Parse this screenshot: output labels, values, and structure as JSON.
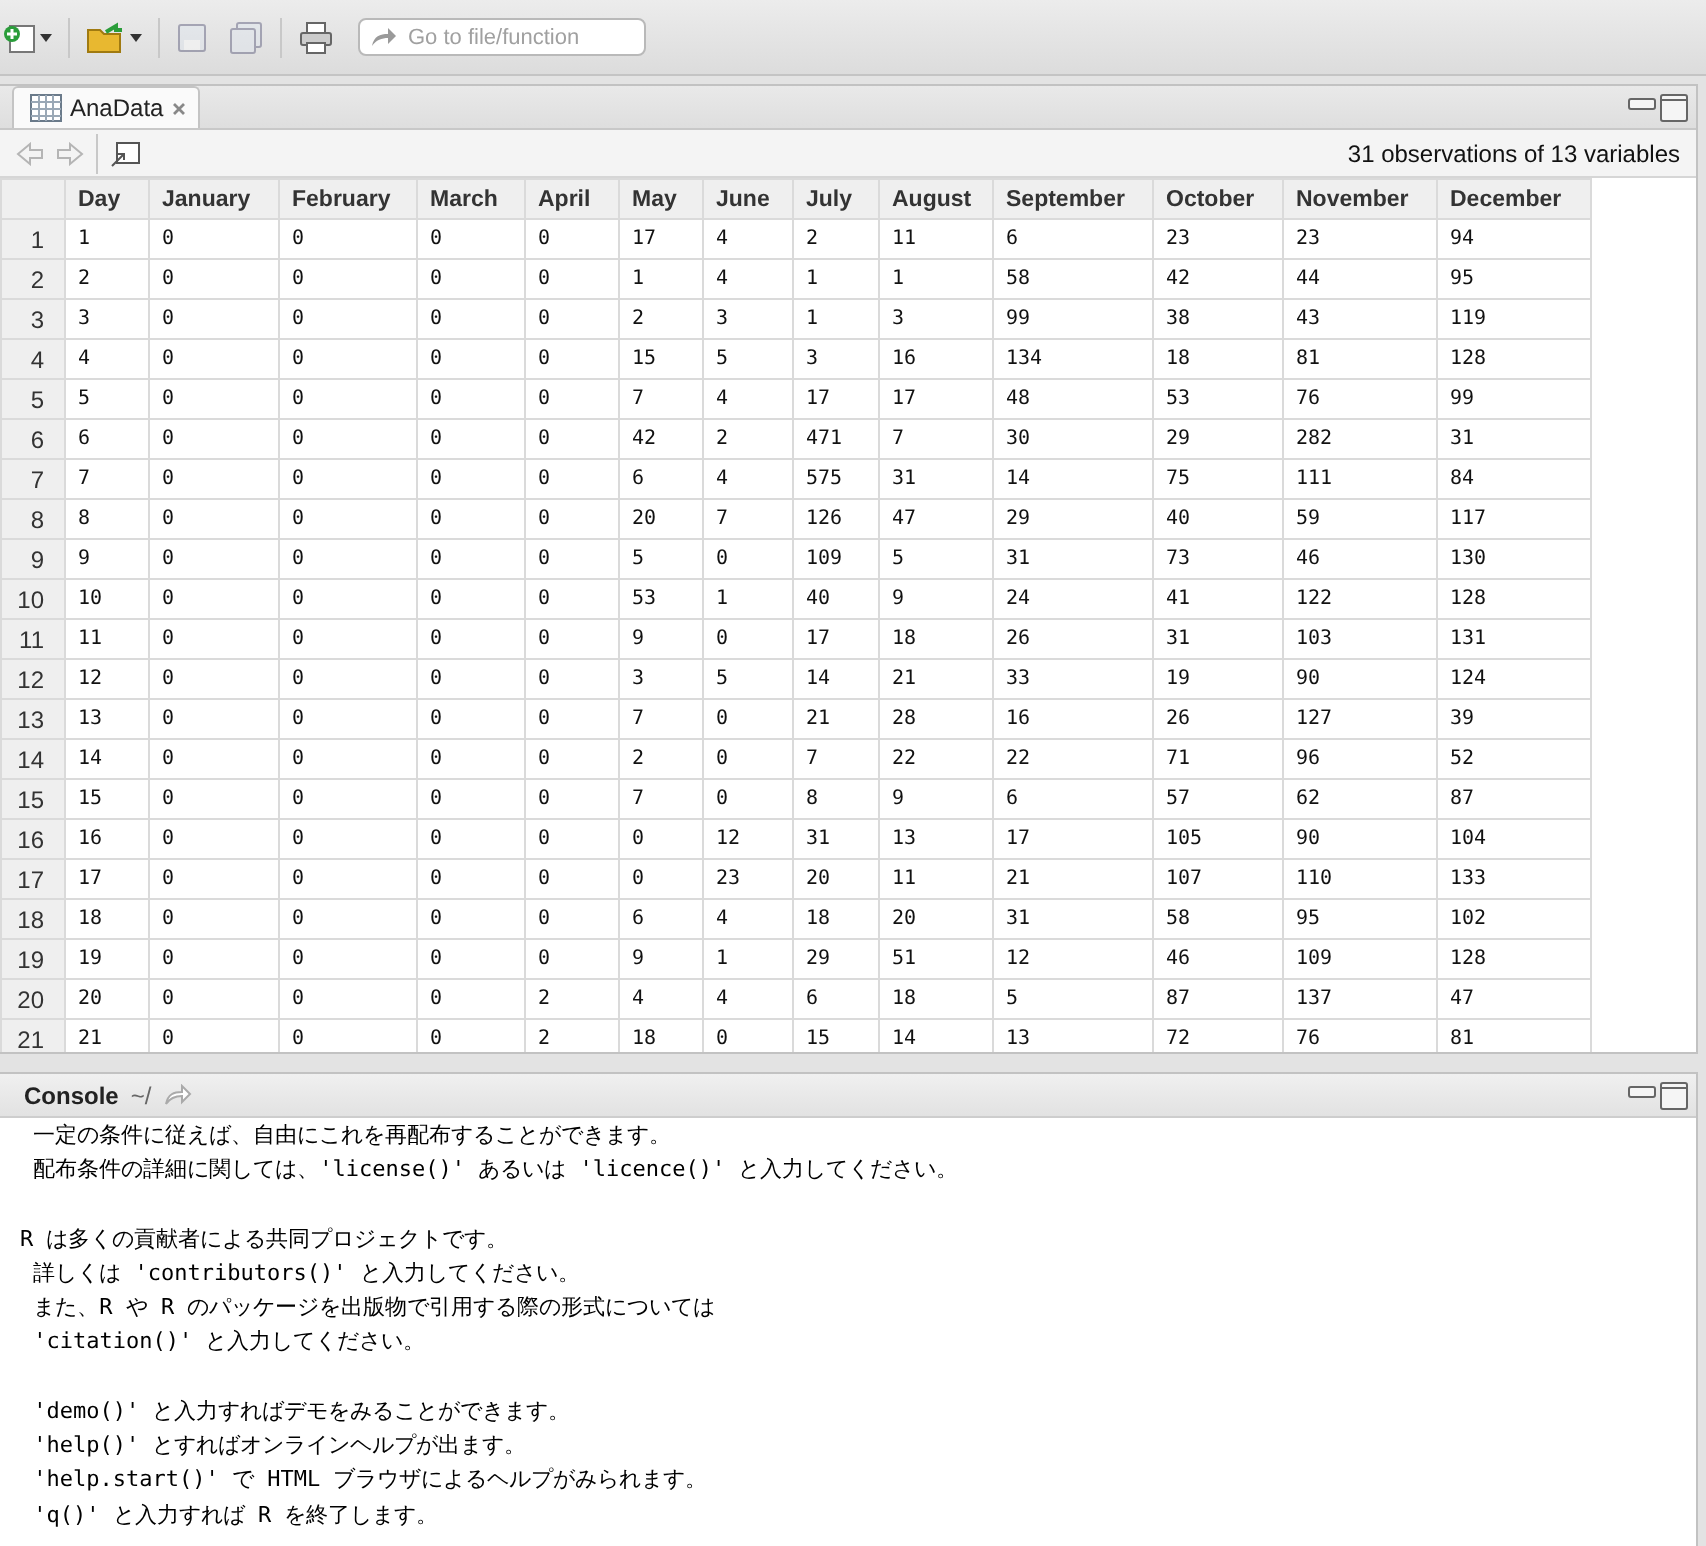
{
  "toolbar": {
    "goto_placeholder": "Go to file/function"
  },
  "data_panel": {
    "tab": {
      "label": "AnaData",
      "selected": true
    },
    "summary": "31 observations of 13 variables"
  },
  "table": {
    "columns": [
      "Day",
      "January",
      "February",
      "March",
      "April",
      "May",
      "June",
      "July",
      "August",
      "September",
      "October",
      "November",
      "December"
    ],
    "rows": [
      {
        "number": "1",
        "cells": [
          "1",
          "0",
          "0",
          "0",
          "0",
          "17",
          "4",
          "2",
          "11",
          "6",
          "23",
          "23",
          "94"
        ]
      },
      {
        "number": "2",
        "cells": [
          "2",
          "0",
          "0",
          "0",
          "0",
          "1",
          "4",
          "1",
          "1",
          "58",
          "42",
          "44",
          "95"
        ]
      },
      {
        "number": "3",
        "cells": [
          "3",
          "0",
          "0",
          "0",
          "0",
          "2",
          "3",
          "1",
          "3",
          "99",
          "38",
          "43",
          "119"
        ]
      },
      {
        "number": "4",
        "cells": [
          "4",
          "0",
          "0",
          "0",
          "0",
          "15",
          "5",
          "3",
          "16",
          "134",
          "18",
          "81",
          "128"
        ]
      },
      {
        "number": "5",
        "cells": [
          "5",
          "0",
          "0",
          "0",
          "0",
          "7",
          "4",
          "17",
          "17",
          "48",
          "53",
          "76",
          "99"
        ]
      },
      {
        "number": "6",
        "cells": [
          "6",
          "0",
          "0",
          "0",
          "0",
          "42",
          "2",
          "471",
          "7",
          "30",
          "29",
          "282",
          "31"
        ]
      },
      {
        "number": "7",
        "cells": [
          "7",
          "0",
          "0",
          "0",
          "0",
          "6",
          "4",
          "575",
          "31",
          "14",
          "75",
          "111",
          "84"
        ]
      },
      {
        "number": "8",
        "cells": [
          "8",
          "0",
          "0",
          "0",
          "0",
          "20",
          "7",
          "126",
          "47",
          "29",
          "40",
          "59",
          "117"
        ]
      },
      {
        "number": "9",
        "cells": [
          "9",
          "0",
          "0",
          "0",
          "0",
          "5",
          "0",
          "109",
          "5",
          "31",
          "73",
          "46",
          "130"
        ]
      },
      {
        "number": "10",
        "cells": [
          "10",
          "0",
          "0",
          "0",
          "0",
          "53",
          "1",
          "40",
          "9",
          "24",
          "41",
          "122",
          "128"
        ]
      },
      {
        "number": "11",
        "cells": [
          "11",
          "0",
          "0",
          "0",
          "0",
          "9",
          "0",
          "17",
          "18",
          "26",
          "31",
          "103",
          "131"
        ]
      },
      {
        "number": "12",
        "cells": [
          "12",
          "0",
          "0",
          "0",
          "0",
          "3",
          "5",
          "14",
          "21",
          "33",
          "19",
          "90",
          "124"
        ]
      },
      {
        "number": "13",
        "cells": [
          "13",
          "0",
          "0",
          "0",
          "0",
          "7",
          "0",
          "21",
          "28",
          "16",
          "26",
          "127",
          "39"
        ]
      },
      {
        "number": "14",
        "cells": [
          "14",
          "0",
          "0",
          "0",
          "0",
          "2",
          "0",
          "7",
          "22",
          "22",
          "71",
          "96",
          "52"
        ]
      },
      {
        "number": "15",
        "cells": [
          "15",
          "0",
          "0",
          "0",
          "0",
          "7",
          "0",
          "8",
          "9",
          "6",
          "57",
          "62",
          "87"
        ]
      },
      {
        "number": "16",
        "cells": [
          "16",
          "0",
          "0",
          "0",
          "0",
          "0",
          "12",
          "31",
          "13",
          "17",
          "105",
          "90",
          "104"
        ]
      },
      {
        "number": "17",
        "cells": [
          "17",
          "0",
          "0",
          "0",
          "0",
          "0",
          "23",
          "20",
          "11",
          "21",
          "107",
          "110",
          "133"
        ]
      },
      {
        "number": "18",
        "cells": [
          "18",
          "0",
          "0",
          "0",
          "0",
          "6",
          "4",
          "18",
          "20",
          "31",
          "58",
          "95",
          "102"
        ]
      },
      {
        "number": "19",
        "cells": [
          "19",
          "0",
          "0",
          "0",
          "0",
          "9",
          "1",
          "29",
          "51",
          "12",
          "46",
          "109",
          "128"
        ]
      },
      {
        "number": "20",
        "cells": [
          "20",
          "0",
          "0",
          "0",
          "2",
          "4",
          "4",
          "6",
          "18",
          "5",
          "87",
          "137",
          "47"
        ]
      },
      {
        "number": "21",
        "cells": [
          "21",
          "0",
          "0",
          "0",
          "2",
          "18",
          "0",
          "15",
          "14",
          "13",
          "72",
          "76",
          "81"
        ]
      }
    ]
  },
  "console": {
    "title": "Console",
    "path": "~/",
    "paragraphs": [
      [
        " 一定の条件に従えば、自由にこれを再配布することができます。",
        " 配布条件の詳細に関しては、'license()' あるいは 'licence()' と入力してください。"
      ],
      [
        "R は多くの貢献者による共同プロジェクトです。",
        " 詳しくは 'contributors()' と入力してください。",
        " また、R や R のパッケージを出版物で引用する際の形式については",
        " 'citation()' と入力してください。"
      ],
      [
        " 'demo()' と入力すればデモをみることができます。",
        " 'help()' とすればオンラインヘルプが出ます。",
        " 'help.start()' で HTML ブラウザによるヘルプがみられます。",
        " 'q()' と入力すれば R を終了します。"
      ]
    ]
  }
}
